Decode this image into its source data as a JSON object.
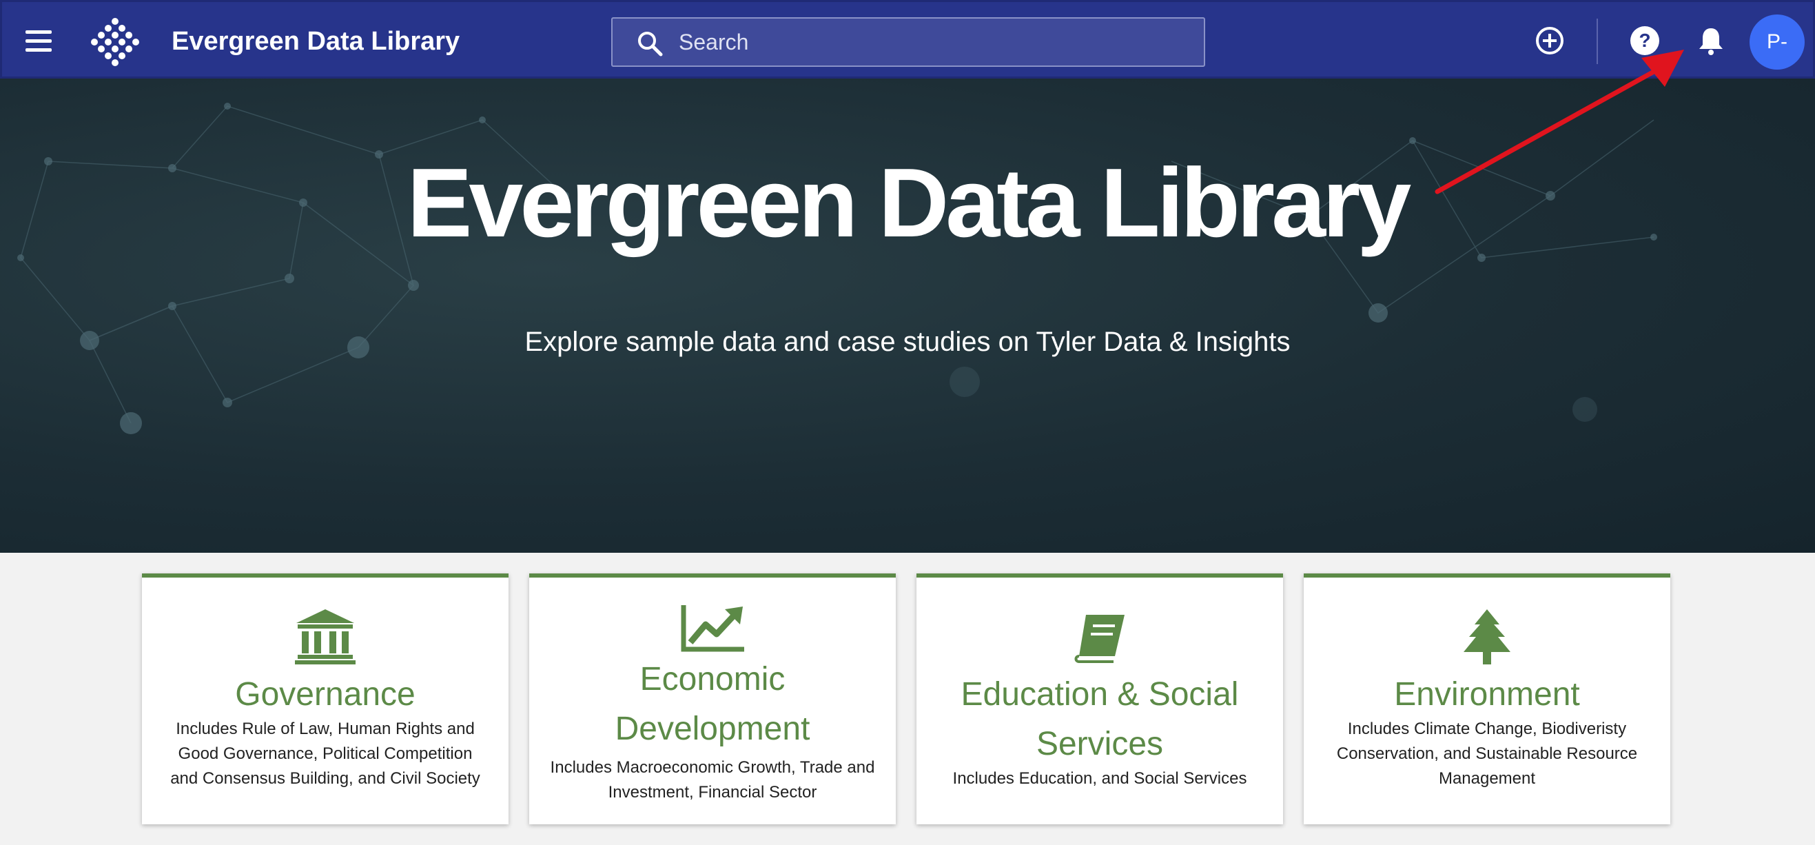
{
  "header": {
    "app_title": "Evergreen Data Library",
    "search_placeholder": "Search",
    "avatar_initials": "P-",
    "icons": [
      "menu-icon",
      "logo-icon",
      "search-icon",
      "add-circle-icon",
      "help-icon",
      "bell-icon"
    ],
    "color": "#27348b"
  },
  "hero": {
    "title": "Evergreen Data Library",
    "subtitle": "Explore sample data and case studies on Tyler Data & Insights"
  },
  "categories": [
    {
      "title": "Governance",
      "description": "Includes Rule of Law, Human Rights and Good Governance, Political Competition and Consensus Building, and Civil Society",
      "icon": "institution-icon"
    },
    {
      "title": "Economic Development",
      "description": "Includes Macroeconomic Growth, Trade and Investment, Financial Sector",
      "icon": "chart-line-icon"
    },
    {
      "title": "Education & Social Services",
      "description": "Includes Education, and Social Services",
      "icon": "book-icon"
    },
    {
      "title": "Environment",
      "description": "Includes Climate Change, Biodiveristy Conservation, and Sustainable Resource Management",
      "icon": "tree-icon"
    }
  ],
  "accent_color": "#5c8a47",
  "annotation_color": "#e0141e"
}
